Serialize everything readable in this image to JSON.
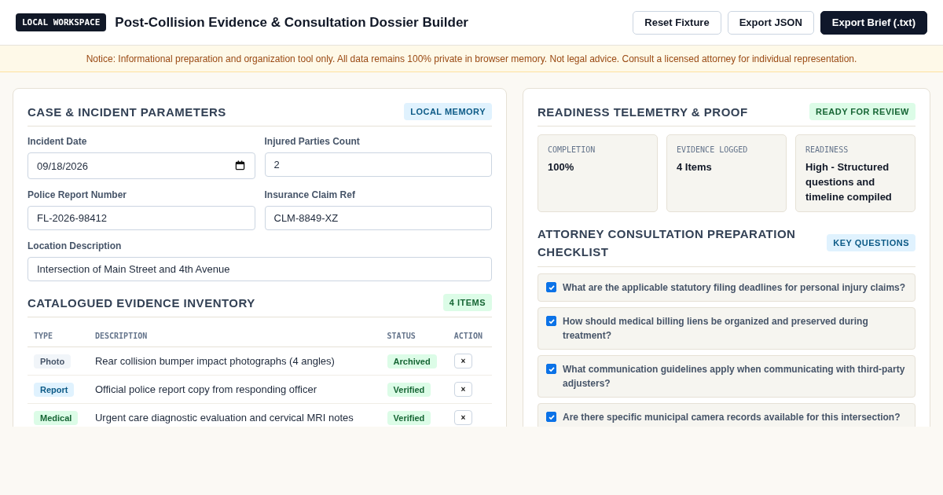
{
  "header": {
    "badge": "LOCAL WORKSPACE",
    "title": "Post-Collision Evidence & Consultation Dossier Builder",
    "buttons": [
      {
        "label": "Reset Fixture",
        "kind": "outline"
      },
      {
        "label": "Export JSON",
        "kind": "outline"
      },
      {
        "label": "Export Brief (.txt)",
        "kind": "primary"
      }
    ]
  },
  "notice": "Notice: Informational preparation and organization tool only. All data remains 100% private in browser memory. Not legal advice. Consult a licensed attorney for individual representation.",
  "case": {
    "title": "CASE & INCIDENT PARAMETERS",
    "badge": "LOCAL MEMORY",
    "fields": [
      {
        "label": "Incident Date",
        "value": "09/18/2026",
        "kind": "date"
      },
      {
        "label": "Injured Parties Count",
        "value": "2",
        "kind": "text"
      },
      {
        "label": "Police Report Number",
        "value": "FL-2026-98412",
        "kind": "text"
      },
      {
        "label": "Insurance Claim Ref",
        "value": "CLM-8849-XZ",
        "kind": "text"
      },
      {
        "label": "Location Description",
        "value": "Intersection of Main Street and 4th Avenue",
        "kind": "wide"
      }
    ]
  },
  "evidence": {
    "title": "CATALOGUED EVIDENCE INVENTORY",
    "badge": "4 ITEMS",
    "columns": [
      "TYPE",
      "DESCRIPTION",
      "STATUS",
      "ACTION"
    ],
    "rows": [
      {
        "type": "Photo",
        "kind": "photo",
        "description": "Rear collision bumper impact photographs (4 angles)",
        "status": "Archived",
        "action": "×"
      },
      {
        "type": "Report",
        "kind": "report",
        "description": "Official police report copy from responding officer",
        "status": "Verified",
        "action": "×"
      },
      {
        "type": "Medical",
        "kind": "medical",
        "description": "Urgent care diagnostic evaluation and cervical MRI notes",
        "status": "Verified",
        "action": "×"
      }
    ]
  },
  "telemetry": {
    "title": "READINESS TELEMETRY & PROOF",
    "badge": "READY FOR REVIEW",
    "stats": [
      {
        "label": "COMPLETION",
        "value": "100%"
      },
      {
        "label": "EVIDENCE LOGGED",
        "value": "4 Items"
      },
      {
        "label": "READINESS",
        "value": "High - Structured questions and timeline compiled"
      }
    ]
  },
  "checklist": {
    "title": "ATTORNEY CONSULTATION PREPARATION CHECKLIST",
    "badge": "KEY QUESTIONS",
    "items": [
      {
        "text": "What are the applicable statutory filing deadlines for personal injury claims?",
        "checked": true
      },
      {
        "text": "How should medical billing liens be organized and preserved during treatment?",
        "checked": true
      },
      {
        "text": "What communication guidelines apply when communicating with third-party adjusters?",
        "checked": true
      },
      {
        "text": "Are there specific municipal camera records available for this intersection?",
        "checked": true
      }
    ]
  }
}
